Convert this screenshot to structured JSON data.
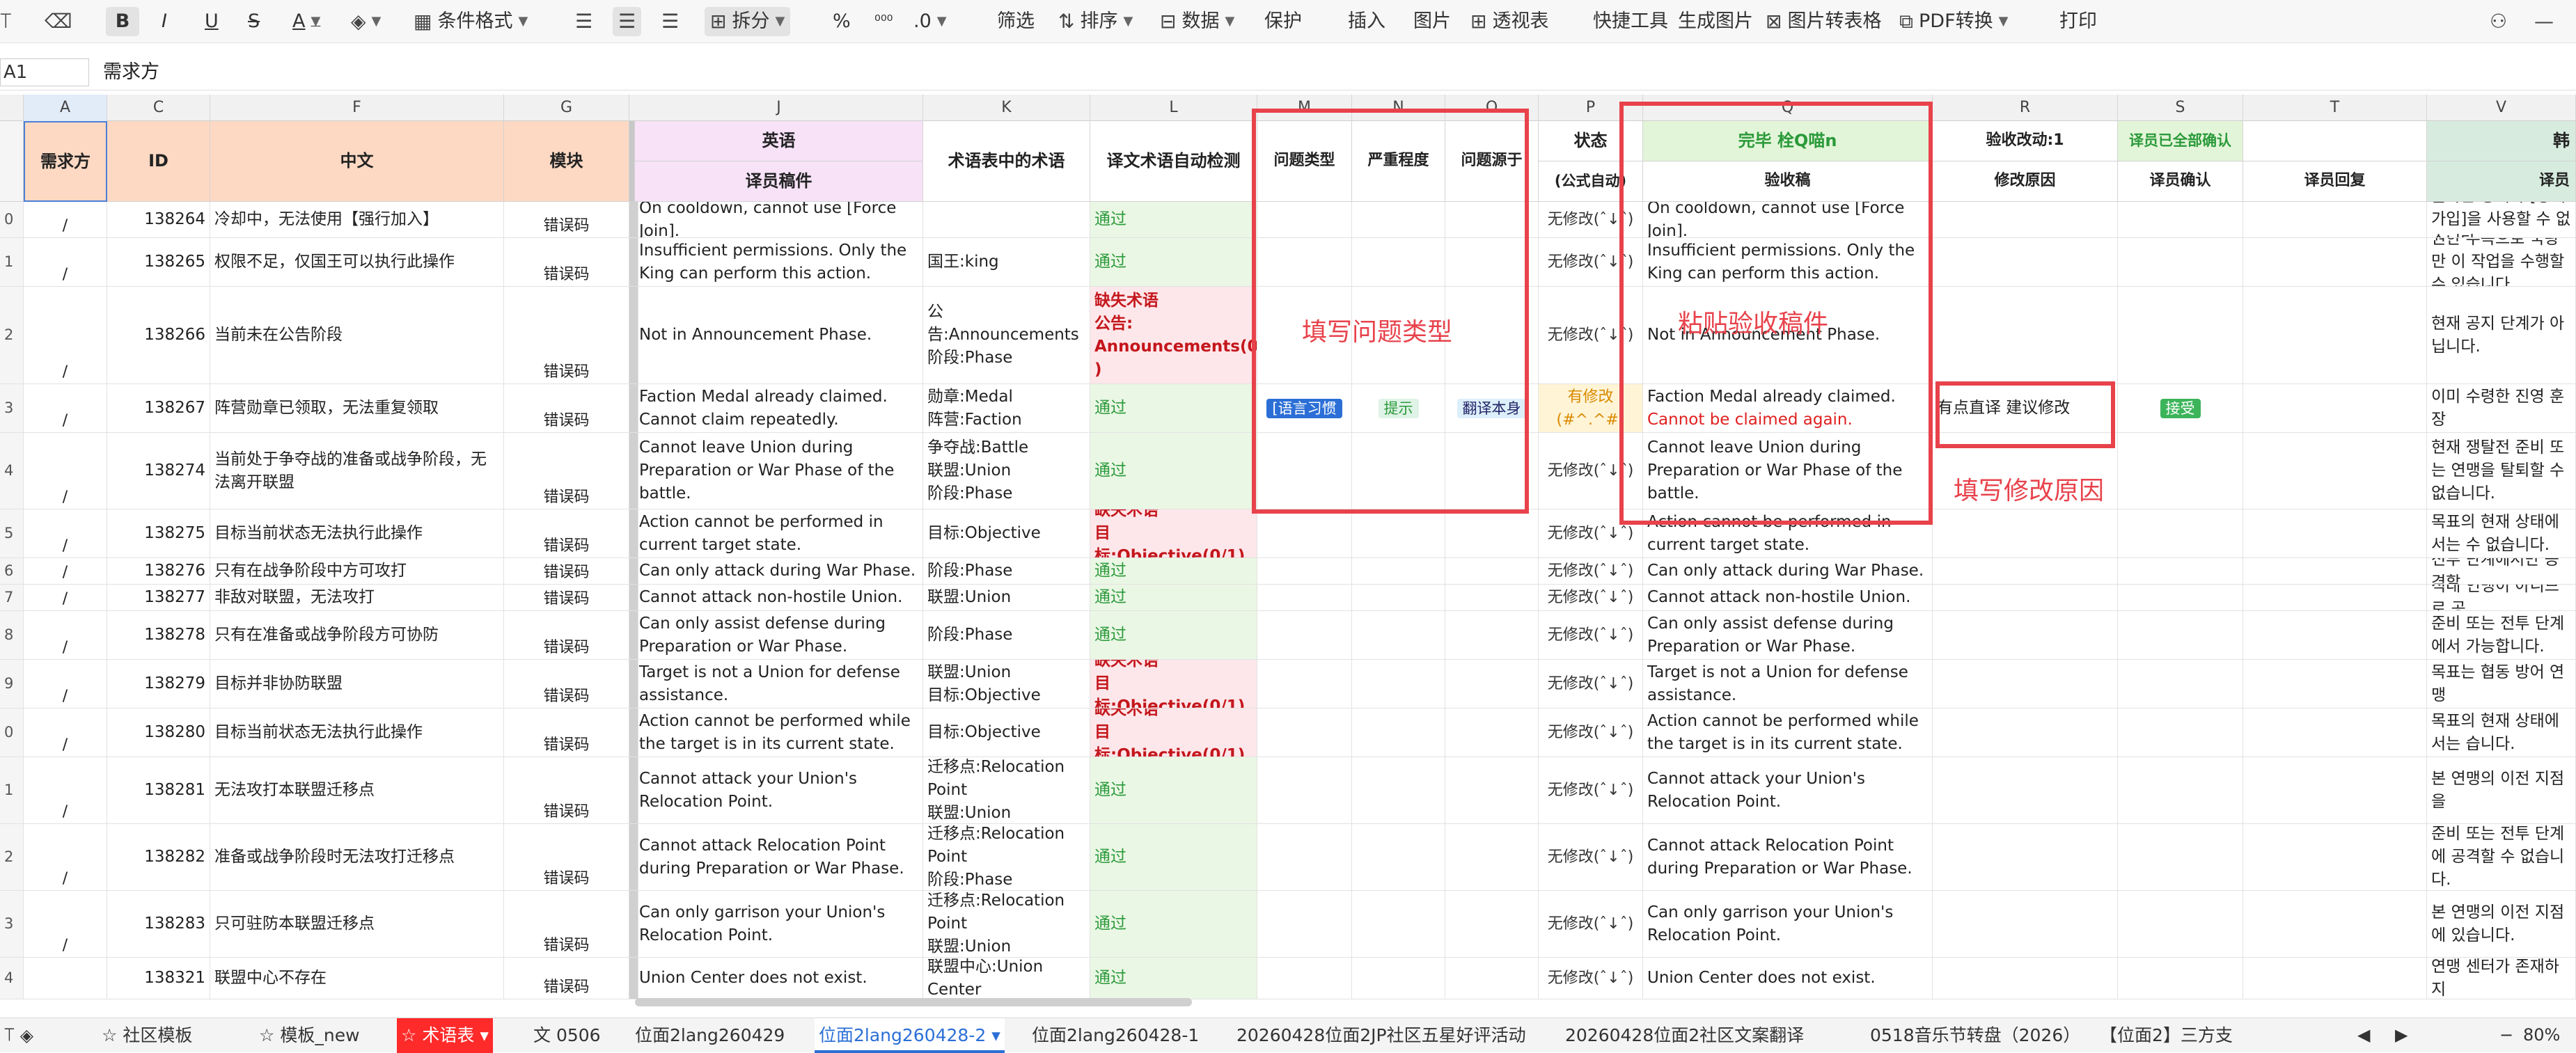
{
  "toolbar": {
    "bold": "B",
    "italic": "I",
    "underline": "U",
    "strike": "S",
    "fontcolor": "A",
    "condfmt": "条件格式",
    "merge": "拆分",
    "percent": "%",
    "thousand": "⁰⁰⁰",
    "decimal": ".0",
    "filter": "筛选",
    "sort": "排序",
    "data": "数据",
    "protect": "保护",
    "insert": "插入",
    "image": "图片",
    "pivot": "透视表",
    "quicktools": "快捷工具",
    "genimage": "生成图片",
    "img2table": "图片转表格",
    "pdfconv": "PDF转换",
    "print": "打印"
  },
  "formula": {
    "cell": "A1",
    "value": "需求方"
  },
  "columns": [
    "A",
    "C",
    "F",
    "G",
    "J",
    "K",
    "L",
    "M",
    "N",
    "O",
    "P",
    "Q",
    "R",
    "S",
    "T",
    "V"
  ],
  "header": {
    "A": "需求方",
    "C": "ID",
    "F": "中文",
    "G": "模块",
    "J_top": "英语",
    "J_sub": "译员稿件",
    "K": "术语表中的术语",
    "L": "译文术语自动检测",
    "M": "问题类型",
    "N": "严重程度",
    "O": "问题源于",
    "P_top": "状态",
    "P_sub": "(公式自动)",
    "Q_top": "完毕 栓Q喵n",
    "Q_sub": "验收稿",
    "R_top": "验收改动:1",
    "R_sub": "修改原因",
    "S_top": "译员已全部确认",
    "S_sub": "译员确认",
    "T_sub": "译员回复",
    "V_top": "韩",
    "V_sub": "译员"
  },
  "rows": [
    {
      "rn": "0",
      "a": "/",
      "id": "138264",
      "zh": "冷却中，无法使用【强行加入】",
      "mod": "错误码",
      "en": "On cooldown, cannot use [Force Join].",
      "term": "",
      "check": "通过",
      "status": "无修改(ˆ↓ˆ)",
      "q": "On cooldown, cannot use [Force Join].",
      "ko": "쿨다운 중이라 [강제 가입]을 사용할 수 없습니다."
    },
    {
      "rn": "1",
      "a": "/",
      "id": "138265",
      "zh": "权限不足，仅国王可以执行此操作",
      "mod": "错误码",
      "en": "Insufficient permissions. Only the King can perform this action.",
      "term": "国王:king",
      "check": "通过",
      "status": "无修改(ˆ↓ˆ)",
      "q": "Insufficient permissions. Only the King can perform this action.",
      "ko": "권한 부족으로 국왕만 이 작업을 수행할 수 있습니다."
    },
    {
      "rn": "2",
      "a": "/",
      "id": "138266",
      "zh": "当前未在公告阶段",
      "mod": "错误码",
      "en": "Not in Announcement Phase.",
      "term": "公告:Announcements\n阶段:Phase",
      "check": "缺失术语\n公告:\nAnnouncements(0/1\n)",
      "status": "无修改(ˆ↓ˆ)",
      "q": "Not in Announcement Phase.",
      "ko": "현재 공지 단계가 아닙니다."
    },
    {
      "rn": "3",
      "a": "/",
      "id": "138267",
      "zh": "阵营勋章已领取，无法重复领取",
      "mod": "错误码",
      "en": "Faction Medal already claimed. Cannot claim repeatedly.",
      "term": "勋章:Medal\n阵营:Faction",
      "check": "通过",
      "m": "[语言习惯",
      "n": "提示",
      "o": "翻译本身",
      "status": "有修改(#^.^#)",
      "q": "Faction Medal already claimed.",
      "q2": "Cannot be claimed again.",
      "r": "有点直译 建议修改",
      "s": "接受",
      "ko": "이미 수령한 진영 훈장"
    },
    {
      "rn": "4",
      "a": "/",
      "id": "138274",
      "zh": "当前处于争夺战的准备或战争阶段，无法离开联盟",
      "mod": "错误码",
      "en": "Cannot leave Union during Preparation or War Phase of the battle.",
      "term": "争夺战:Battle\n联盟:Union\n阶段:Phase",
      "check": "通过",
      "status": "无修改(ˆ↓ˆ)",
      "q": "Cannot leave Union during Preparation or War Phase of the battle.",
      "ko": "현재 쟁탈전 준비 또는 연맹을 탈퇴할 수 없습니다."
    },
    {
      "rn": "5",
      "a": "/",
      "id": "138275",
      "zh": "目标当前状态无法执行此操作",
      "mod": "错误码",
      "en": "Action cannot be performed in current target state.",
      "term": "目标:Objective",
      "check": "缺失术语\n目标:Objective(0/1)",
      "status": "无修改(ˆ↓ˆ)",
      "q": "Action cannot be performed in current target state.",
      "ko": "목표의 현재 상태에서는 수 없습니다."
    },
    {
      "rn": "6",
      "a": "/",
      "id": "138276",
      "zh": "只有在战争阶段中方可攻打",
      "mod": "错误码",
      "en": "Can only attack during War Phase.",
      "term": "阶段:Phase",
      "check": "通过",
      "status": "无修改(ˆ↓ˆ)",
      "q": "Can only attack during War Phase.",
      "ko": "전투 단계에서만 공격할"
    },
    {
      "rn": "7",
      "a": "/",
      "id": "138277",
      "zh": "非敌对联盟，无法攻打",
      "mod": "错误码",
      "en": "Cannot attack non-hostile Union.",
      "term": "联盟:Union",
      "check": "通过",
      "status": "无修改(ˆ↓ˆ)",
      "q": "Cannot attack non-hostile Union.",
      "ko": "적대 연맹이 아니므로 공"
    },
    {
      "rn": "8",
      "a": "/",
      "id": "138278",
      "zh": "只有在准备或战争阶段方可协防",
      "mod": "错误码",
      "en": "Can only assist defense during Preparation or War Phase.",
      "term": "阶段:Phase",
      "check": "通过",
      "status": "无修改(ˆ↓ˆ)",
      "q": "Can only assist defense during Preparation or War Phase.",
      "ko": "준비 또는 전투 단계에서 가능합니다."
    },
    {
      "rn": "9",
      "a": "/",
      "id": "138279",
      "zh": "目标并非协防联盟",
      "mod": "错误码",
      "en": "Target is not a Union for defense assistance.",
      "term": "联盟:Union\n目标:Objective",
      "check": "缺失术语\n目标:Objective(0/1)",
      "status": "无修改(ˆ↓ˆ)",
      "q": "Target is not a Union for defense assistance.",
      "ko": "목표는 협동 방어 연맹"
    },
    {
      "rn": "0",
      "a": "/",
      "id": "138280",
      "zh": "目标当前状态无法执行此操作",
      "mod": "错误码",
      "en": "Action cannot be performed while the target is in its current state.",
      "term": "目标:Objective",
      "check": "缺失术语\n目标:Objective(0/1)",
      "status": "无修改(ˆ↓ˆ)",
      "q": "Action cannot be performed while the target is in its current state.",
      "ko": "목표의 현재 상태에서는 습니다."
    },
    {
      "rn": "1",
      "a": "/",
      "id": "138281",
      "zh": "无法攻打本联盟迁移点",
      "mod": "错误码",
      "en": "Cannot attack your Union's Relocation Point.",
      "term": "迁移点:Relocation\nPoint\n联盟:Union",
      "check": "通过",
      "status": "无修改(ˆ↓ˆ)",
      "q": "Cannot attack your Union's Relocation Point.",
      "ko": "본 연맹의 이전 지점을"
    },
    {
      "rn": "2",
      "a": "/",
      "id": "138282",
      "zh": "准备或战争阶段时无法攻打迁移点",
      "mod": "错误码",
      "en": "Cannot attack Relocation Point during Preparation or War Phase.",
      "term": "迁移点:Relocation\nPoint\n阶段:Phase",
      "check": "通过",
      "status": "无修改(ˆ↓ˆ)",
      "q": "Cannot attack Relocation Point during Preparation or War Phase.",
      "ko": "준비 또는 전투 단계에 공격할 수 없습니다."
    },
    {
      "rn": "3",
      "a": "/",
      "id": "138283",
      "zh": "只可驻防本联盟迁移点",
      "mod": "错误码",
      "en": "Can only garrison your Union's Relocation Point.",
      "term": "迁移点:Relocation\nPoint\n联盟:Union",
      "check": "通过",
      "status": "无修改(ˆ↓ˆ)",
      "q": "Can only garrison your Union's Relocation Point.",
      "ko": "본 연맹의 이전 지점에 있습니다."
    },
    {
      "rn": "4",
      "a": "",
      "id": "138321",
      "zh": "联盟中心不存在",
      "mod": "错误码",
      "en": "Union Center does not exist.",
      "term": "联盟中心:Union\nCenter",
      "check": "通过",
      "status": "无修改(ˆ↓ˆ)",
      "q": "Union Center does not exist.",
      "ko": "연맹 센터가 존재하지"
    }
  ],
  "annotations": {
    "fill_type": "填写问题类型",
    "paste_accept": "粘贴验收稿件",
    "fill_reason": "填写修改原因"
  },
  "tabs": [
    "社区模板",
    "模板_new",
    "术语表",
    "文 0506",
    "位面2lang260429",
    "位面2lang260428-2",
    "位面2lang260428-1",
    "20260428位面2JP社区五星好评活动",
    "20260428位面2社区文案翻译",
    "0518音乐节转盘（2026）",
    "【位面2】三方支"
  ],
  "zoom": "80%",
  "colors": {
    "accent_red": "#e8424b",
    "active_tab": "#ff2a2a",
    "selected_tab": "#2b6fd6",
    "pass_green": "#2c9a3c",
    "miss_red": "#c4161c"
  }
}
